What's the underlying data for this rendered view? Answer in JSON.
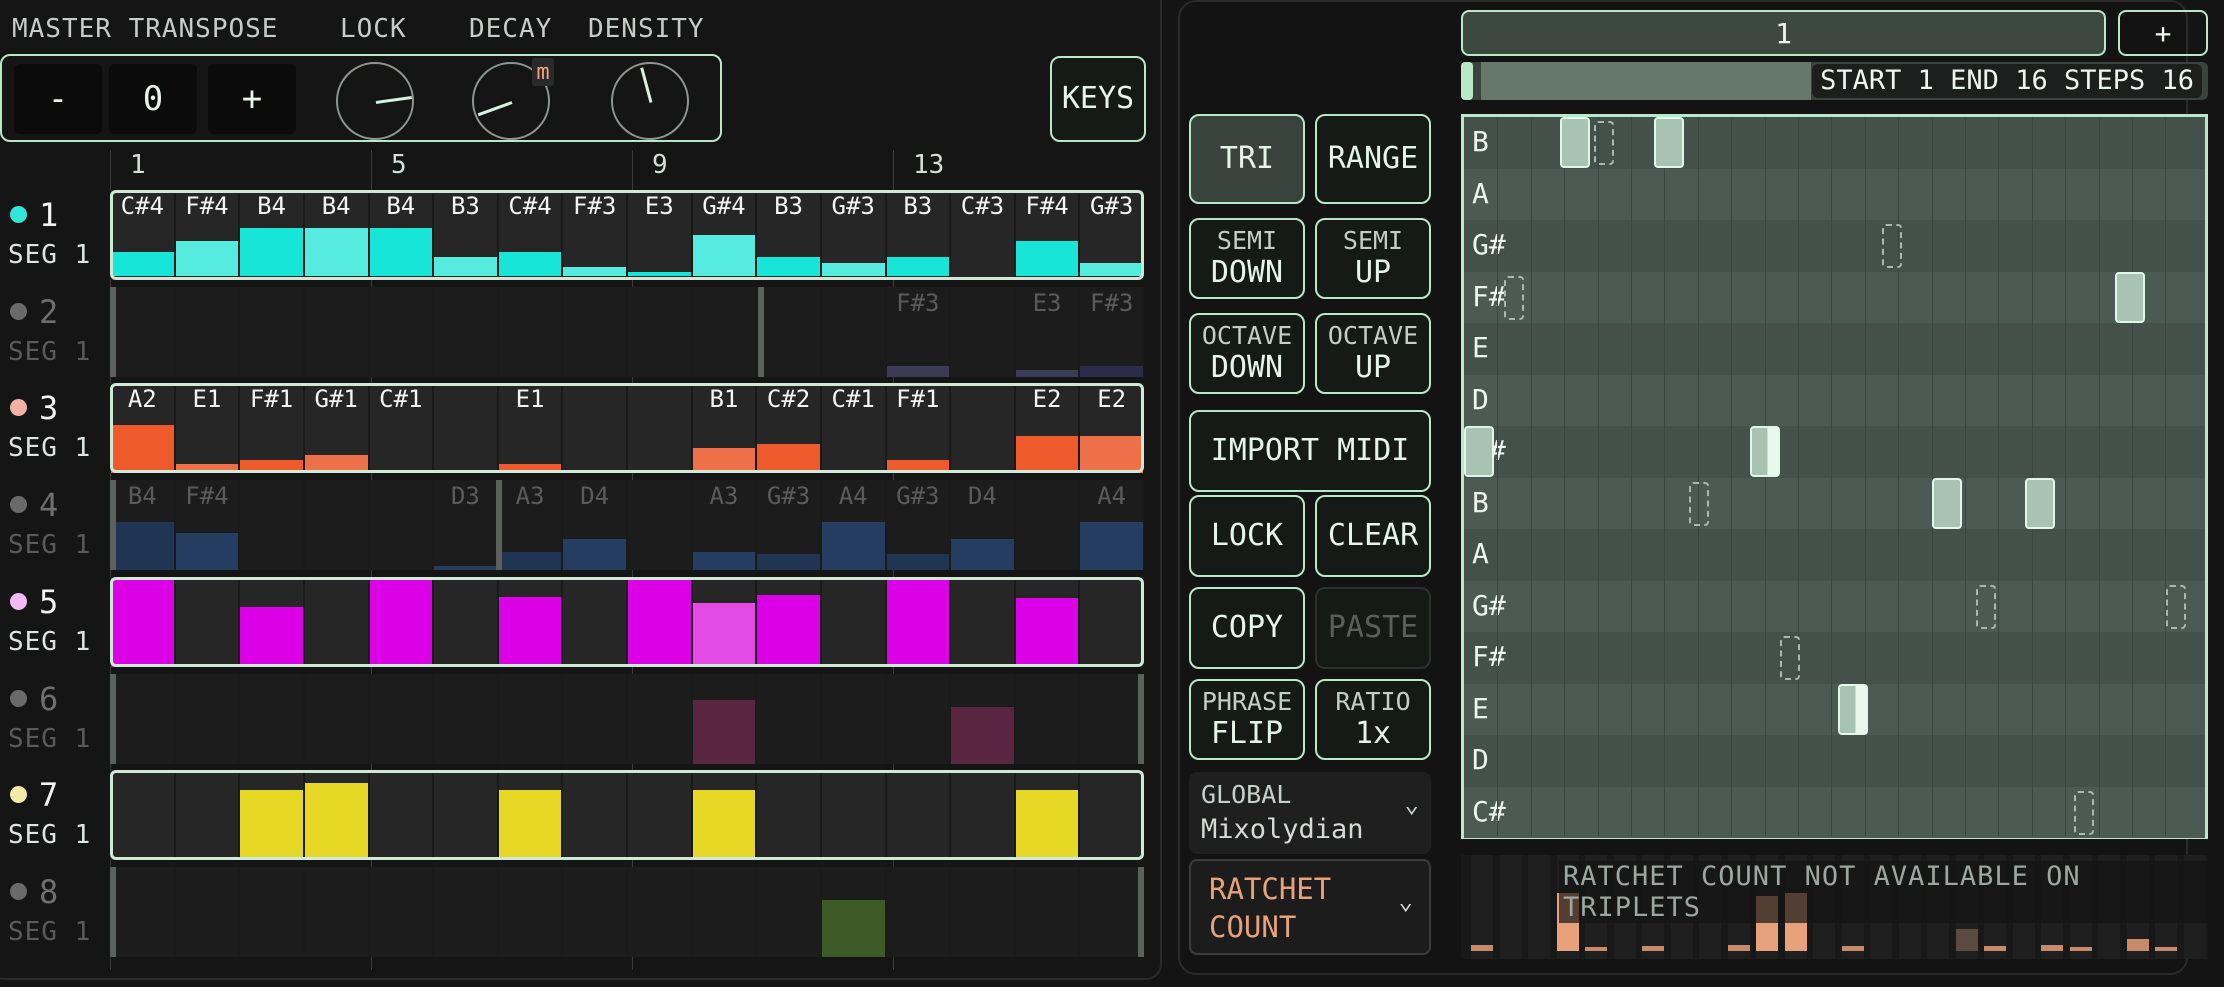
{
  "header": {
    "master_transpose": "MASTER TRANSPOSE",
    "lock": "LOCK",
    "decay": "DECAY",
    "density": "DENSITY"
  },
  "transpose": {
    "minus": "-",
    "value": "0",
    "plus": "+"
  },
  "decay_badge": "m",
  "keys_button": "KEYS",
  "step_numbers": [
    "1",
    "5",
    "9",
    "13"
  ],
  "tracks": [
    {
      "num": "1",
      "seg": "SEG 1",
      "color": "#2fe6d9",
      "dim": false,
      "notes": [
        "C#4",
        "F#4",
        "B4",
        "B4",
        "B4",
        "B3",
        "C#4",
        "F#3",
        "E3",
        "G#4",
        "B3",
        "G#3",
        "B3",
        "C#3",
        "F#4",
        "G#3"
      ],
      "levels": [
        0.27,
        0.4,
        0.55,
        0.55,
        0.55,
        0.22,
        0.27,
        0.1,
        0.05,
        0.47,
        0.22,
        0.15,
        0.22,
        0.0,
        0.4,
        0.15
      ]
    },
    {
      "num": "2",
      "seg": "SEG 1",
      "color": "#6a6a6a",
      "dim": true,
      "notes": [
        "",
        "",
        "",
        "",
        "",
        "",
        "",
        "",
        "",
        "",
        "",
        "",
        "F#3",
        "",
        "E3",
        "F#3"
      ],
      "levels": [
        0,
        0,
        0,
        0,
        0,
        0,
        0,
        0,
        0,
        0,
        0,
        0,
        0.12,
        0,
        0.08,
        0.12
      ]
    },
    {
      "num": "3",
      "seg": "SEG 1",
      "color": "#f3b2a1",
      "dim": false,
      "notes": [
        "A2",
        "E1",
        "F#1",
        "G#1",
        "C#1",
        "",
        "E1",
        "",
        "",
        "B1",
        "C#2",
        "C#1",
        "F#1",
        "",
        "E2",
        "E2"
      ],
      "levels": [
        0.55,
        0.1,
        0.15,
        0.2,
        0.02,
        0,
        0.1,
        0,
        0,
        0.28,
        0.33,
        0.02,
        0.15,
        0,
        0.42,
        0.42
      ]
    },
    {
      "num": "4",
      "seg": "SEG 1",
      "color": "#6a6a6a",
      "dim": true,
      "notes": [
        "B4",
        "F#4",
        "",
        "",
        "",
        "D3",
        "A3",
        "D4",
        "",
        "A3",
        "G#3",
        "A4",
        "G#3",
        "D4",
        "",
        "A4"
      ],
      "levels": [
        0.55,
        0.42,
        0,
        0,
        0,
        0.05,
        0.2,
        0.35,
        0,
        0.2,
        0.18,
        0.55,
        0.18,
        0.35,
        0,
        0.55
      ]
    },
    {
      "num": "5",
      "seg": "SEG 1",
      "color": "#f2b9f2",
      "dim": false,
      "notes": [
        "",
        "",
        "",
        "",
        "",
        "",
        "",
        "",
        "",
        "",
        "",
        "",
        "",
        "",
        "",
        ""
      ],
      "levels": [
        1,
        0,
        0.68,
        0,
        1,
        0,
        0.8,
        0,
        1,
        0.73,
        0.82,
        0,
        1,
        0,
        0.78,
        0
      ]
    },
    {
      "num": "6",
      "seg": "SEG 1",
      "color": "#6a6a6a",
      "dim": true,
      "notes": [
        "",
        "",
        "",
        "",
        "",
        "",
        "",
        "",
        "",
        "",
        "",
        "",
        "",
        "",
        "",
        ""
      ],
      "levels": [
        0,
        0,
        0,
        0,
        0,
        0,
        0,
        0,
        0,
        0.73,
        0,
        0,
        0,
        0.65,
        0,
        0
      ]
    },
    {
      "num": "7",
      "seg": "SEG 1",
      "color": "#f2eba8",
      "dim": false,
      "notes": [
        "",
        "",
        "",
        "",
        "",
        "",
        "",
        "",
        "",
        "",
        "",
        "",
        "",
        "",
        "",
        ""
      ],
      "levels": [
        0,
        0,
        0.8,
        0.88,
        0,
        0,
        0.8,
        0,
        0,
        0.8,
        0,
        0,
        0,
        0,
        0.8,
        0
      ]
    },
    {
      "num": "8",
      "seg": "SEG 1",
      "color": "#6a6a6a",
      "dim": true,
      "notes": [
        "",
        "",
        "",
        "",
        "",
        "",
        "",
        "",
        "",
        "",
        "",
        "",
        "",
        "",
        "",
        ""
      ],
      "levels": [
        0,
        0,
        0,
        0,
        0,
        0,
        0,
        0,
        0,
        0,
        0,
        0.65,
        0,
        0,
        0,
        0
      ]
    }
  ],
  "buttons": {
    "tri": "TRI",
    "range": "RANGE",
    "semi": "SEMI",
    "down": "DOWN",
    "up": "UP",
    "octave": "OCTAVE",
    "import_midi": "IMPORT MIDI",
    "lock": "LOCK",
    "clear": "CLEAR",
    "copy": "COPY",
    "paste": "PASTE",
    "phrase": "PHRASE",
    "flip": "FLIP",
    "ratio": "RATIO",
    "ratio_value": "1x"
  },
  "scale_select": {
    "label": "GLOBAL",
    "value": "Mixolydian"
  },
  "ratchet_select": {
    "value": "RATCHET COUNT"
  },
  "pattern": {
    "value": "1",
    "add": "+"
  },
  "loop_info": "START 1 END 16 STEPS 16",
  "piano_roll": {
    "rows": [
      "B",
      "A",
      "G#",
      "F#",
      "E",
      "D",
      "C#",
      "B",
      "A",
      "G#",
      "F#",
      "E",
      "D",
      "C#"
    ]
  },
  "ratchet_message": "RATCHET COUNT NOT AVAILABLE ON TRIPLETS",
  "colors": {
    "accent": "#b9e8c8",
    "t1": "#16e5d7",
    "t3": "#ee5a2c",
    "t5": "#db00e6",
    "t7": "#e7d826"
  }
}
